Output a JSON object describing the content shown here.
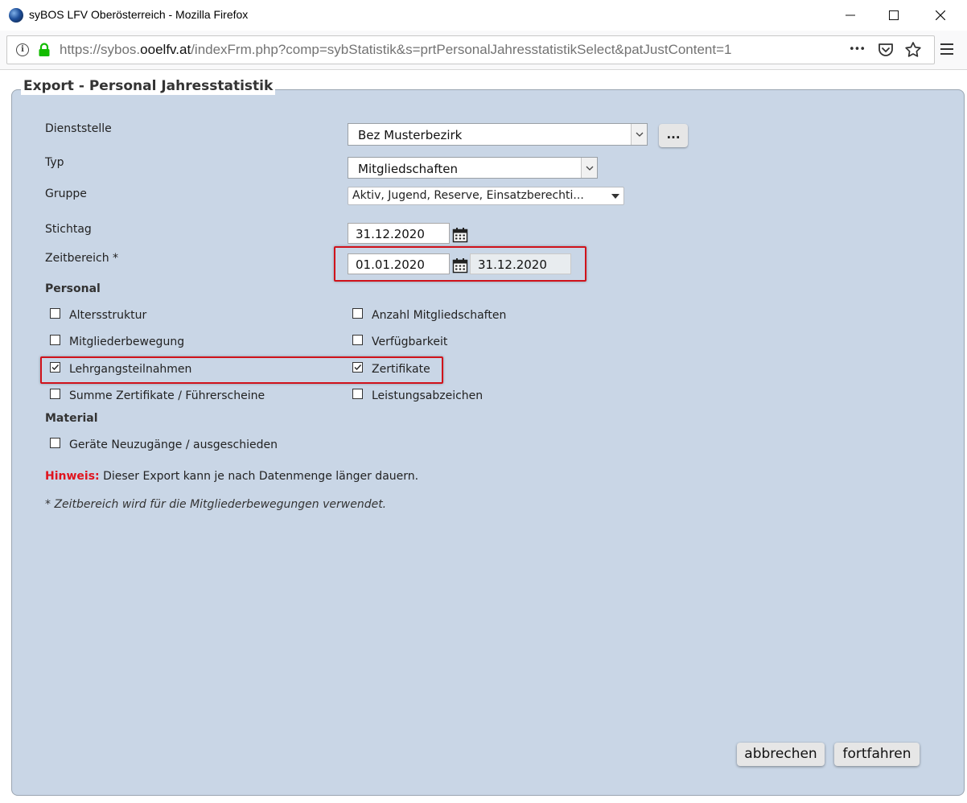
{
  "window": {
    "title": "syBOS LFV Oberösterreich - Mozilla Firefox",
    "minimize": "—",
    "maximize": "☐",
    "close": "✕"
  },
  "urlbar": {
    "url_prefix": "https://sybos.",
    "url_domain": "ooelfv.at",
    "url_suffix": "/indexFrm.php?comp=sybStatistik&s=prtPersonalJahresstatistikSelect&patJustContent=1",
    "more": "•••"
  },
  "dialog": {
    "title": "Export - Personal Jahresstatistik",
    "fields": {
      "dienststelle": {
        "label": "Dienststelle",
        "value": "Bez Musterbezirk",
        "button": "..."
      },
      "typ": {
        "label": "Typ",
        "value": "Mitgliedschaften"
      },
      "gruppe": {
        "label": "Gruppe",
        "value": "Aktiv, Jugend, Reserve, Einsatzberechti..."
      },
      "stichtag": {
        "label": "Stichtag",
        "value": "31.12.2020"
      },
      "zeitbereich": {
        "label": "Zeitbereich *",
        "from": "01.01.2020",
        "to": "31.12.2020"
      }
    },
    "personal": {
      "heading": "Personal",
      "items": [
        {
          "label": "Altersstruktur",
          "checked": false
        },
        {
          "label": "Anzahl Mitgliedschaften",
          "checked": false
        },
        {
          "label": "Mitgliederbewegung",
          "checked": false
        },
        {
          "label": "Verfügbarkeit",
          "checked": false
        },
        {
          "label": "Lehrgangsteilnahmen",
          "checked": true
        },
        {
          "label": "Zertifikate",
          "checked": true
        },
        {
          "label": "Summe Zertifikate / Führerscheine",
          "checked": false
        },
        {
          "label": "Leistungsabzeichen",
          "checked": false
        }
      ]
    },
    "material": {
      "heading": "Material",
      "items": [
        {
          "label": "Geräte Neuzugänge / ausgeschieden",
          "checked": false
        }
      ]
    },
    "hint": {
      "prefix": "Hinweis:",
      "text": " Dieser Export kann je nach Datenmenge länger dauern."
    },
    "footnote": "* Zeitbereich wird für die Mitgliederbewegungen verwendet.",
    "buttons": {
      "cancel": "abbrechen",
      "continue": "fortfahren"
    }
  },
  "colors": {
    "dialog_bg": "#c9d6e6",
    "highlight": "#d0121b",
    "warning": "#e0141e",
    "lock": "#12bc00"
  }
}
